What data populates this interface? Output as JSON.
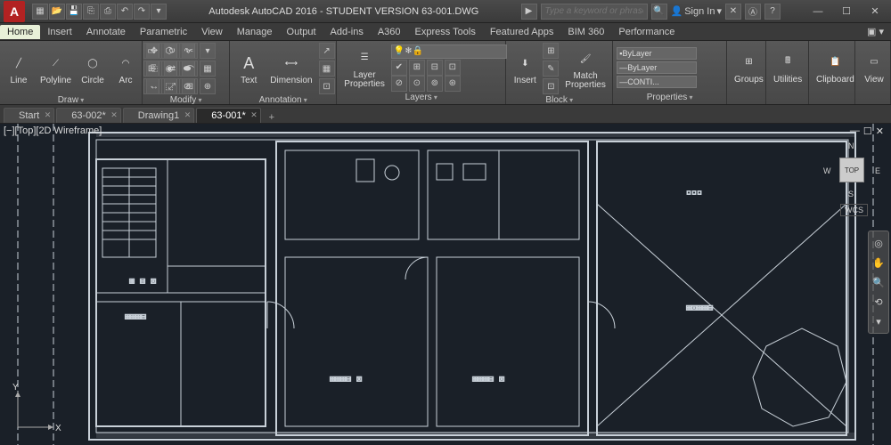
{
  "app": {
    "logo_letter": "A",
    "title": "Autodesk AutoCAD 2016 - STUDENT VERSION   63-001.DWG",
    "search_placeholder": "Type a keyword or phrase",
    "sign_in": "Sign In"
  },
  "menu_tabs": [
    "Home",
    "Insert",
    "Annotate",
    "Parametric",
    "View",
    "Manage",
    "Output",
    "Add-ins",
    "A360",
    "Express Tools",
    "Featured Apps",
    "BIM 360",
    "Performance"
  ],
  "menu_active": "Home",
  "ribbon": {
    "draw": {
      "title": "Draw",
      "buttons": [
        "Line",
        "Polyline",
        "Circle",
        "Arc"
      ]
    },
    "modify": {
      "title": "Modify"
    },
    "annotation": {
      "title": "Annotation",
      "text": "Text",
      "dim": "Dimension"
    },
    "layers": {
      "title": "Layers",
      "lp": "Layer\nProperties",
      "current": ""
    },
    "block": {
      "title": "Block",
      "insert": "Insert",
      "match": "Match\nProperties"
    },
    "properties": {
      "title": "Properties",
      "color": "ByLayer",
      "ltype": "ByLayer",
      "lweight": "CONTI..."
    },
    "groups": {
      "title": "Groups"
    },
    "utilities": {
      "title": "Utilities"
    },
    "clipboard": {
      "title": "Clipboard"
    },
    "view": {
      "title": "View"
    }
  },
  "filetabs": [
    {
      "label": "Start",
      "active": false,
      "dirty": false
    },
    {
      "label": "63-002",
      "active": false,
      "dirty": true
    },
    {
      "label": "Drawing1",
      "active": false,
      "dirty": false
    },
    {
      "label": "63-001",
      "active": true,
      "dirty": true
    }
  ],
  "viewport": {
    "label": "[−][Top][2D Wireframe]",
    "cube_face": "TOP",
    "wcs": "WCS",
    "dirs": {
      "n": "N",
      "e": "E",
      "s": "S",
      "w": "W"
    }
  },
  "ucs": {
    "x": "X",
    "y": "Y"
  }
}
